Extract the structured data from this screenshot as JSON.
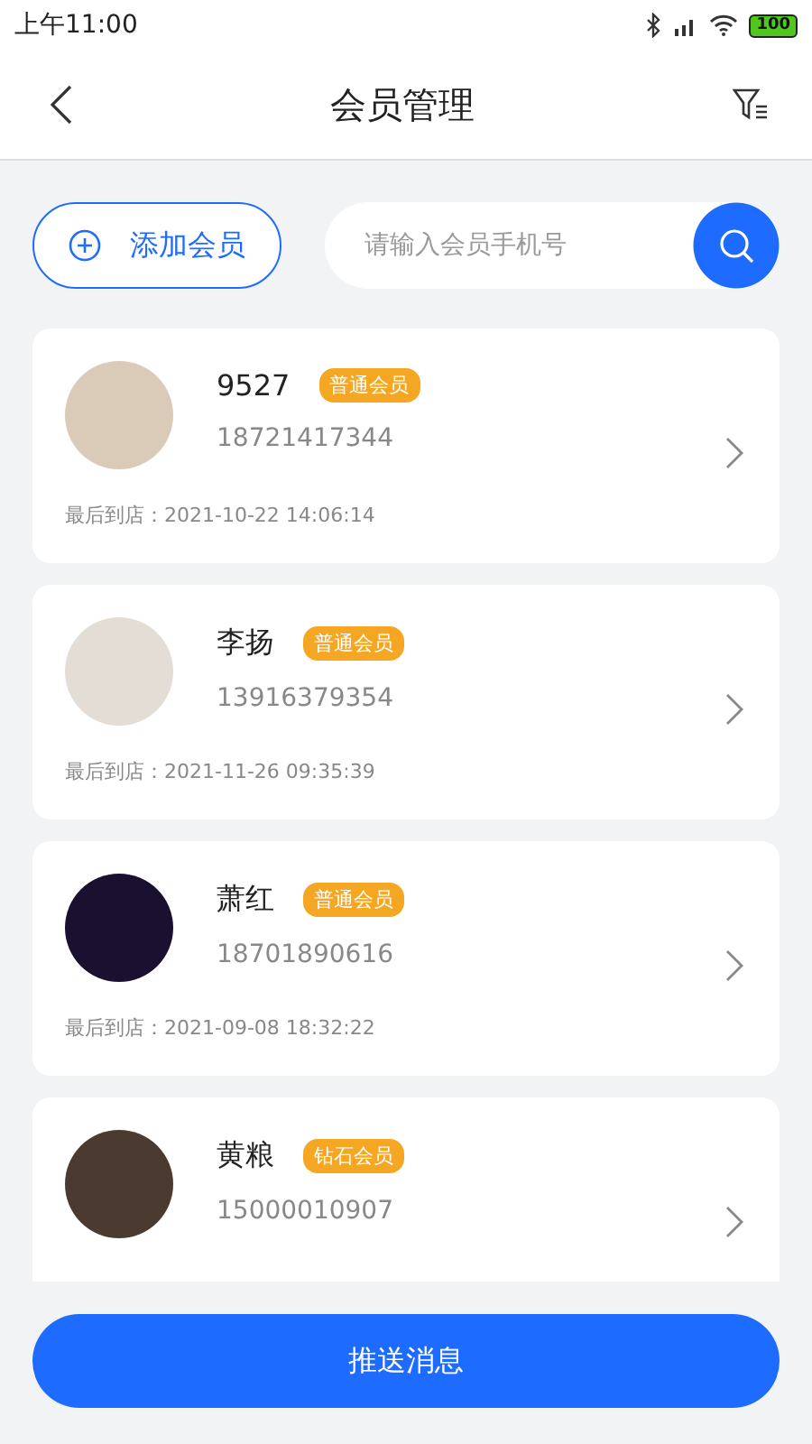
{
  "status_bar": {
    "time": "上午11:00",
    "battery": "100"
  },
  "header": {
    "title": "会员管理"
  },
  "add_button": {
    "label": "添加会员"
  },
  "search": {
    "placeholder": "请输入会员手机号"
  },
  "members": [
    {
      "name": "9527",
      "tier": "普通会员",
      "phone": "18721417344",
      "last_visit": "最后到店：2021-10-22 14:06:14"
    },
    {
      "name": "李扬",
      "tier": "普通会员",
      "phone": "13916379354",
      "last_visit": "最后到店：2021-11-26 09:35:39"
    },
    {
      "name": "萧红",
      "tier": "普通会员",
      "phone": "18701890616",
      "last_visit": "最后到店：2021-09-08 18:32:22"
    },
    {
      "name": "黄粮",
      "tier": "钻石会员",
      "phone": "15000010907"
    }
  ],
  "push_button": {
    "label": "推送消息"
  }
}
